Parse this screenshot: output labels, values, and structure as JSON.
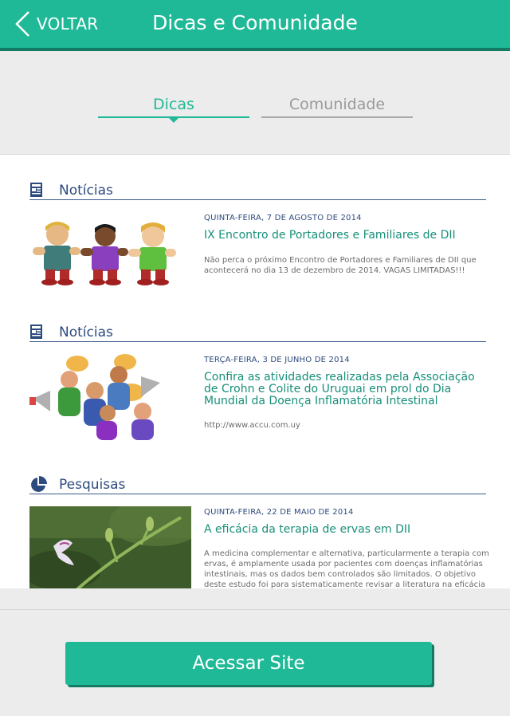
{
  "header": {
    "back_label": "VOLTAR",
    "title": "Dicas e Comunidade"
  },
  "tabs": [
    {
      "label": "Dicas",
      "active": true
    },
    {
      "label": "Comunidade",
      "active": false
    }
  ],
  "feed": [
    {
      "category": "Notícias",
      "icon": "newspaper-icon",
      "date": "QUINTA-FEIRA, 7 DE AGOSTO DE 2014",
      "title": "IX Encontro de Portadores e Familiares de DII",
      "excerpt": "Não perca o próximo Encontro de Portadores e Familiares de DII que acontecerá no dia 13 de dezembro de 2014. VAGAS LIMITADAS!!!"
    },
    {
      "category": "Notícias",
      "icon": "newspaper-icon",
      "date": "TERÇA-FEIRA, 3 DE JUNHO DE 2014",
      "title": "Confira as atividades realizadas pela Associação de Crohn e Colite do Uruguai em prol do Dia Mundial da Doença Inflamatória Intestinal",
      "excerpt": "http://www.accu.com.uy"
    },
    {
      "category": "Pesquisas",
      "icon": "pie-chart-icon",
      "date": "QUINTA-FEIRA, 22 DE MAIO DE 2014",
      "title": "A eficácia da terapia de ervas em DII",
      "excerpt": "A medicina complementar e alternativa, particularmente a terapia com ervas, é amplamente usada por pacientes com doenças inflamatórias intestinais, mas os dados bem controlados são limitados. O objetivo deste estudo foi para sistematicamente revisar a literatura na eficácia da"
    }
  ],
  "footer": {
    "button_label": "Acessar Site"
  },
  "colors": {
    "accent": "#1fb997",
    "accent_dark": "#157a63",
    "section_blue": "#2d4a7e",
    "link_green": "#178f7a"
  }
}
